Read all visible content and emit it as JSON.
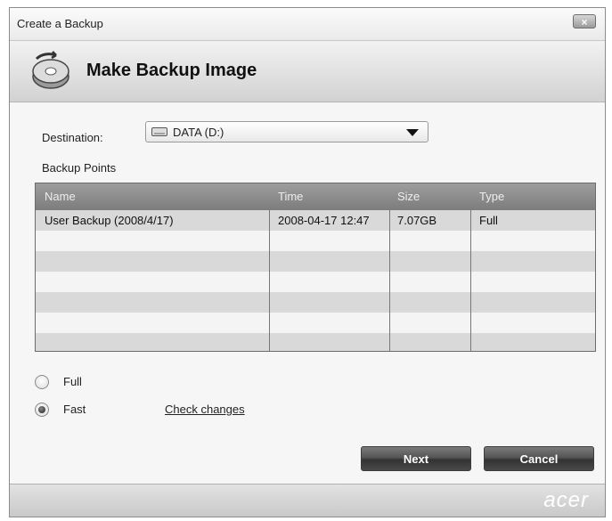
{
  "window": {
    "title": "Create a Backup",
    "close_label": "×"
  },
  "header": {
    "title": "Make Backup Image"
  },
  "destination": {
    "label": "Destination:",
    "value": "DATA (D:)"
  },
  "backup_points": {
    "label": "Backup Points",
    "columns": [
      "Name",
      "Time",
      "Size",
      "Type"
    ],
    "rows": [
      {
        "name": "User Backup (2008/4/17)",
        "time": "2008-04-17 12:47",
        "size": "7.07GB",
        "type": "Full"
      }
    ]
  },
  "options": {
    "full_label": "Full",
    "fast_label": "Fast",
    "selected": "Fast",
    "check_changes_label": "Check changes"
  },
  "buttons": {
    "next_label": "Next",
    "cancel_label": "Cancel"
  },
  "footer": {
    "brand": "acer"
  }
}
